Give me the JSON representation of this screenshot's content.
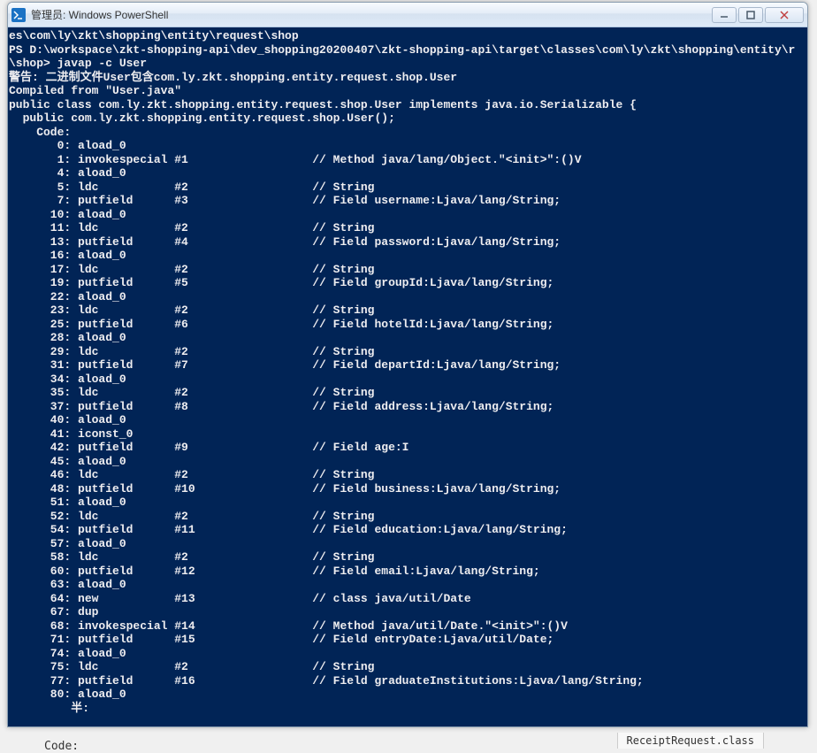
{
  "window": {
    "title": "管理员: Windows PowerShell"
  },
  "terminal": {
    "lines": [
      "es\\com\\ly\\zkt\\shopping\\entity\\request\\shop",
      "PS D:\\workspace\\zkt-shopping-api\\dev_shopping20200407\\zkt-shopping-api\\target\\classes\\com\\ly\\zkt\\shopping\\entity\\r",
      "\\shop> javap -c User",
      "警告: 二进制文件User包含com.ly.zkt.shopping.entity.request.shop.User",
      "Compiled from \"User.java\"",
      "public class com.ly.zkt.shopping.entity.request.shop.User implements java.io.Serializable {",
      "  public com.ly.zkt.shopping.entity.request.shop.User();",
      "    Code:",
      "       0: aload_0",
      "       1: invokespecial #1                  // Method java/lang/Object.\"<init>\":()V",
      "       4: aload_0",
      "       5: ldc           #2                  // String",
      "       7: putfield      #3                  // Field username:Ljava/lang/String;",
      "      10: aload_0",
      "      11: ldc           #2                  // String",
      "      13: putfield      #4                  // Field password:Ljava/lang/String;",
      "      16: aload_0",
      "      17: ldc           #2                  // String",
      "      19: putfield      #5                  // Field groupId:Ljava/lang/String;",
      "      22: aload_0",
      "      23: ldc           #2                  // String",
      "      25: putfield      #6                  // Field hotelId:Ljava/lang/String;",
      "      28: aload_0",
      "      29: ldc           #2                  // String",
      "      31: putfield      #7                  // Field departId:Ljava/lang/String;",
      "      34: aload_0",
      "      35: ldc           #2                  // String",
      "      37: putfield      #8                  // Field address:Ljava/lang/String;",
      "      40: aload_0",
      "      41: iconst_0",
      "      42: putfield      #9                  // Field age:I",
      "      45: aload_0",
      "      46: ldc           #2                  // String",
      "      48: putfield      #10                 // Field business:Ljava/lang/String;",
      "      51: aload_0",
      "      52: ldc           #2                  // String",
      "      54: putfield      #11                 // Field education:Ljava/lang/String;",
      "      57: aload_0",
      "      58: ldc           #2                  // String",
      "      60: putfield      #12                 // Field email:Ljava/lang/String;",
      "      63: aload_0",
      "      64: new           #13                 // class java/util/Date",
      "      67: dup",
      "      68: invokespecial #14                 // Method java/util/Date.\"<init>\":()V",
      "      71: putfield      #15                 // Field entryDate:Ljava/util/Date;",
      "      74: aload_0",
      "      75: ldc           #2                  // String",
      "      77: putfield      #16                 // Field graduateInstitutions:Ljava/lang/String;",
      "      80: aload_0",
      "         半:"
    ]
  },
  "background": {
    "code_label": "Code:",
    "file_tab": "ReceiptRequest.class"
  }
}
